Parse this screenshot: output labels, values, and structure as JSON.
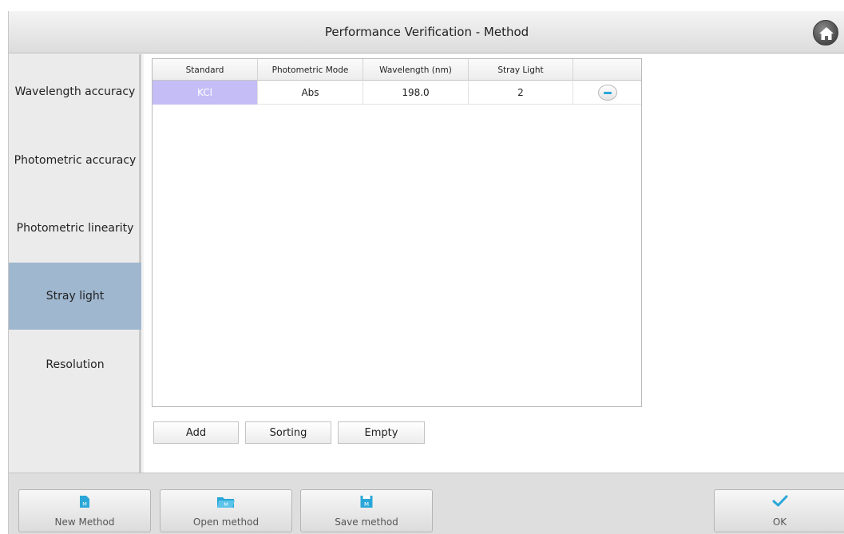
{
  "window": {
    "title": "Performance Verification - Method"
  },
  "sidebar": {
    "items": [
      {
        "label": "Wavelength accuracy"
      },
      {
        "label": "Photometric accuracy"
      },
      {
        "label": "Photometric linearity"
      },
      {
        "label": "Stray light",
        "active": true
      },
      {
        "label": "Resolution"
      }
    ]
  },
  "table": {
    "headers": [
      "Standard",
      "Photometric Mode",
      "Wavelength (nm)",
      "Stray Light",
      ""
    ],
    "rows": [
      {
        "standard": "KCl",
        "mode": "Abs",
        "wavelength": "198.0",
        "stray_light": "2"
      }
    ]
  },
  "actions": {
    "add": "Add",
    "sorting": "Sorting",
    "empty": "Empty"
  },
  "toolbar": {
    "new_method": "New Method",
    "open_method": "Open method",
    "save_method": "Save method",
    "ok": "OK"
  },
  "colors": {
    "accent": "#2aa7d8",
    "active_tab": "#9fb7cf",
    "selected_cell": "#c4bdf6"
  },
  "icons": [
    "home-icon",
    "minus-icon",
    "new-method-icon",
    "open-method-icon",
    "save-method-icon",
    "checkmark-icon"
  ]
}
